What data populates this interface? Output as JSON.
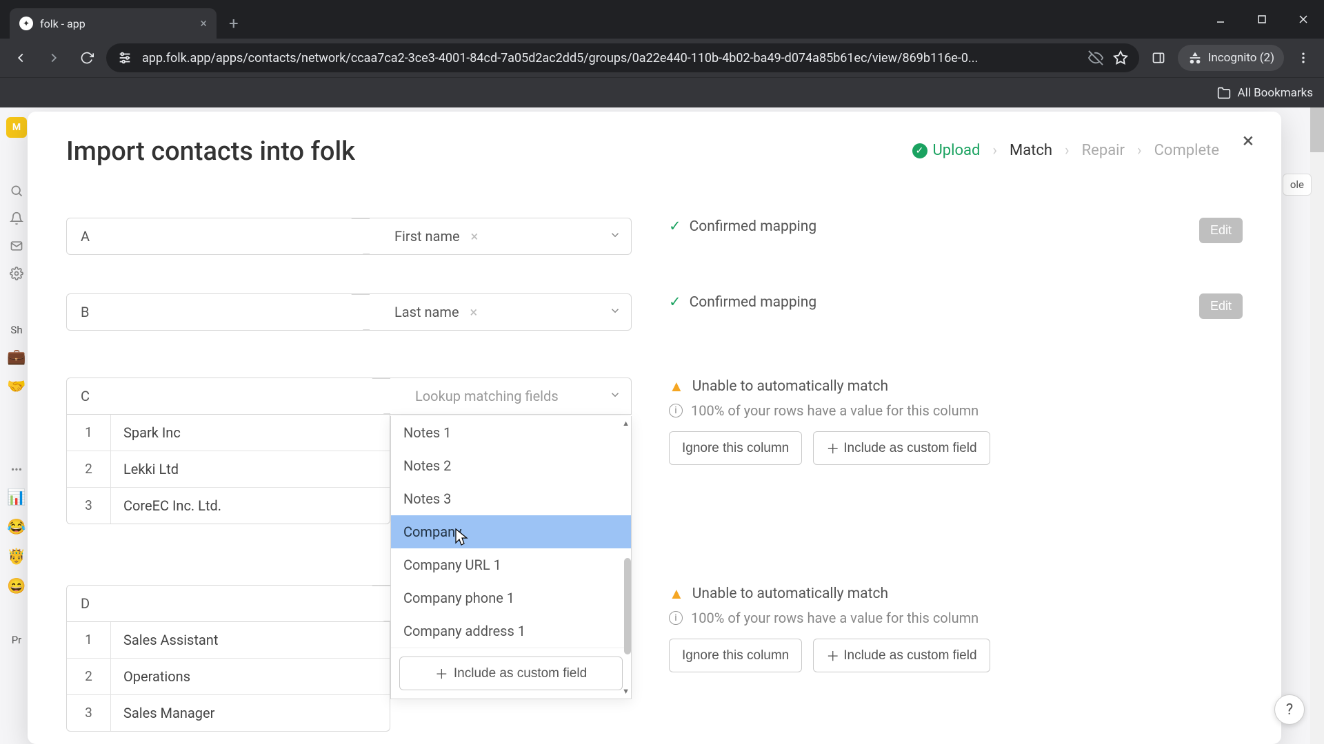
{
  "browser": {
    "tab_title": "folk - app",
    "url": "app.folk.app/apps/contacts/network/ccaa7ca2-3ce3-4001-84cd-7a05d2ac2dd5/groups/0a22e440-110b-4b02-ba49-d074a85b61ec/view/869b116e-0...",
    "incognito_label": "Incognito (2)",
    "all_bookmarks": "All Bookmarks"
  },
  "sidebar": {
    "avatar_letter": "M",
    "label_sh": "Sh",
    "label_pr": "Pr"
  },
  "right_chip": "ole",
  "modal": {
    "title": "Import contacts into folk",
    "steps": {
      "upload": "Upload",
      "match": "Match",
      "repair": "Repair",
      "complete": "Complete"
    },
    "mappings": [
      {
        "letter": "A",
        "field": "First name",
        "status": "Confirmed mapping",
        "edit_label": "Edit"
      },
      {
        "letter": "B",
        "field": "Last name",
        "status": "Confirmed mapping",
        "edit_label": "Edit"
      }
    ],
    "col_c": {
      "letter": "C",
      "placeholder": "Lookup matching fields",
      "rows": [
        {
          "idx": "1",
          "val": "Spark Inc"
        },
        {
          "idx": "2",
          "val": "Lekki Ltd"
        },
        {
          "idx": "3",
          "val": "CoreEC Inc. Ltd."
        }
      ],
      "warn": "Unable to automatically match",
      "info": "100% of your rows have a value for this column",
      "ignore": "Ignore this column",
      "include": "Include as custom field"
    },
    "dropdown": {
      "items": [
        "Notes 1",
        "Notes 2",
        "Notes 3",
        "Company",
        "Company URL 1",
        "Company phone 1",
        "Company address 1"
      ],
      "highlight_index": 3,
      "footer_btn": "Include as custom field"
    },
    "col_d": {
      "letter": "D",
      "rows": [
        {
          "idx": "1",
          "val": "Sales Assistant"
        },
        {
          "idx": "2",
          "val": "Operations"
        },
        {
          "idx": "3",
          "val": "Sales Manager"
        }
      ],
      "warn": "Unable to automatically match",
      "info": "100% of your rows have a value for this column",
      "ignore": "Ignore this column",
      "include": "Include as custom field"
    }
  },
  "help": "?"
}
